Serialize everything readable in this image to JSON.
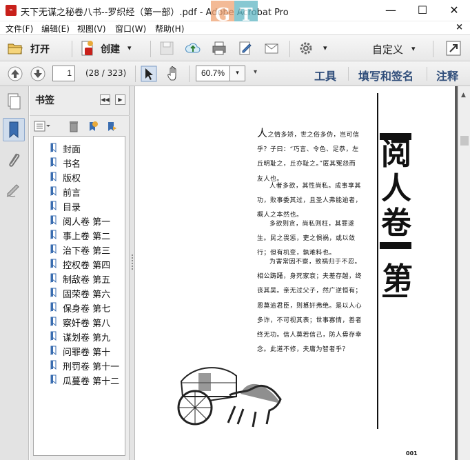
{
  "window": {
    "title": "天下无谋之秘卷八书--罗织经（第一部）.pdf - Adobe Acrobat Pro",
    "watermark": [
      "G",
      "T"
    ],
    "minimize_glyph": "—",
    "maximize_glyph": "☐",
    "close_glyph": "✕"
  },
  "menubar": {
    "items": [
      "文件(F)",
      "编辑(E)",
      "视图(V)",
      "窗口(W)",
      "帮助(H)"
    ],
    "close_glyph": "×"
  },
  "toolbar1": {
    "open_label": "打开",
    "create_label": "创建",
    "custom_label": "自定义",
    "dropdown_glyph": "▾"
  },
  "toolbar2": {
    "page_value": "1",
    "page_count": "(28 / 323)",
    "zoom_value": "60.7%",
    "zoom_dropdown_glyph": "▾",
    "pane_links": [
      "工具",
      "填写和签名",
      "注释"
    ]
  },
  "bookmarks": {
    "title": "书签",
    "collapse_glyph": "◀◀",
    "expand_glyph": "▶",
    "items": [
      {
        "label": "封面"
      },
      {
        "label": "书名"
      },
      {
        "label": "版权"
      },
      {
        "label": "前言"
      },
      {
        "label": "目录"
      },
      {
        "label": "阅人卷 第一"
      },
      {
        "label": "事上卷 第二"
      },
      {
        "label": "治下卷 第三"
      },
      {
        "label": "控权卷 第四"
      },
      {
        "label": "制敌卷 第五"
      },
      {
        "label": "固荣卷 第六"
      },
      {
        "label": "保身卷 第七"
      },
      {
        "label": "察奸卷 第八"
      },
      {
        "label": "谋划卷 第九"
      },
      {
        "label": "问罪卷 第十"
      },
      {
        "label": "刑罚卷 第十一"
      },
      {
        "label": "瓜蔓卷 第十二"
      }
    ]
  },
  "document": {
    "chapter_title_chars": [
      "阅",
      "人",
      "卷"
    ],
    "chapter_number": "第",
    "page_number": "001",
    "paragraphs": [
      "人之情多矫，世之俗多伪，岂可信乎？子曰：“巧言、令色、足恭，左丘明耻之，丘亦耻之。”匿其冤怨而友人也。",
      "人者多欲，其性尚私。成事享其功，败事委其过，且圣人弗能逾者，概人之本然也。",
      "多欲则贪，尚私则枉，其罪遂生。民之畏惩，吏之惧祸，或以敛行；但有机变，孰难料也。",
      "为害常因不察，致祸归于不忍。相公踌躇，身死家衰；夫差存越，终丧其吴。亲无过父子，然广逆恒有；恩莫逾君臣，则篡奸弗绝。是以人心多诈，不可视其表；世事寡情，善者终无功。信人莫若信己，防人毋存幸念。此道不修，夫庸为智者乎？"
    ]
  }
}
